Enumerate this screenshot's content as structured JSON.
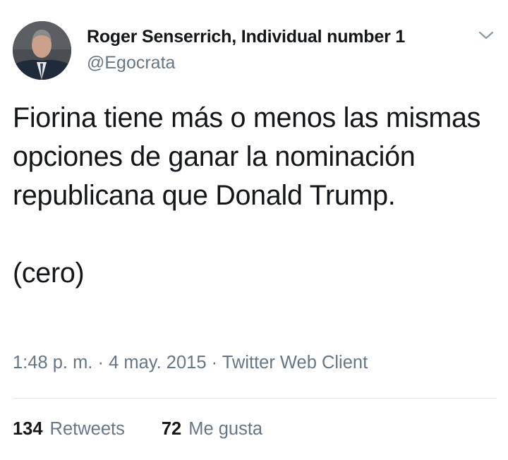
{
  "tweet": {
    "author_name": "Roger Senserrich, Individual number 1",
    "author_handle": "@Egocrata",
    "text": "Fiorina tiene más o menos las mismas opciones de ganar la nominación republicana que Donald Trump.\n\n(cero)",
    "time": "1:48 p. m.",
    "separator": " · ",
    "date": "4 may. 2015",
    "source": "Twitter Web Client",
    "retweets_count": "134",
    "retweets_label": "Retweets",
    "likes_count": "72",
    "likes_label": "Me gusta"
  },
  "icons": {
    "caret": "chevron-down-icon",
    "avatar": "profile-photo"
  },
  "colors": {
    "primary_text": "#14171a",
    "secondary_text": "#657786",
    "divider": "#e1e8ed"
  }
}
